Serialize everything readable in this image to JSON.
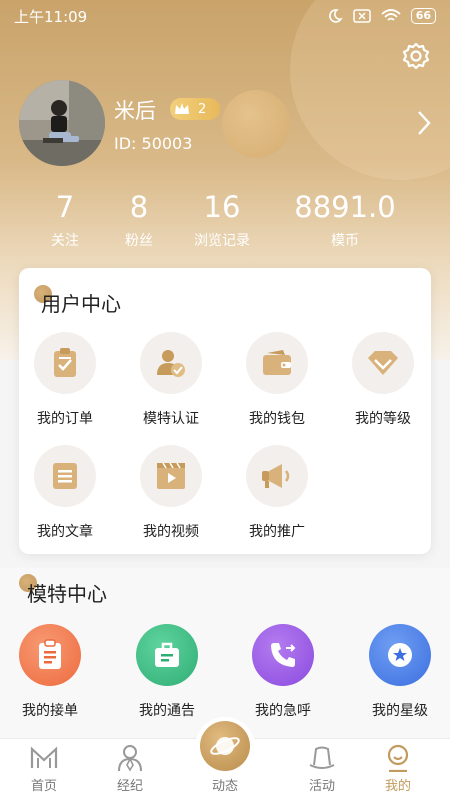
{
  "status_bar": {
    "time": "上午11:09",
    "battery": "66"
  },
  "profile": {
    "name": "米后",
    "vip_level": "2",
    "user_id": "ID: 50003"
  },
  "stats": [
    {
      "value": "7",
      "label": "关注"
    },
    {
      "value": "8",
      "label": "粉丝"
    },
    {
      "value": "16",
      "label": "浏览记录"
    },
    {
      "value": "8891.0",
      "label": "模币"
    }
  ],
  "user_center": {
    "title": "用户中心",
    "items": [
      {
        "label": "我的订单",
        "icon": "order-clipboard-icon"
      },
      {
        "label": "模特认证",
        "icon": "certify-user-icon"
      },
      {
        "label": "我的钱包",
        "icon": "wallet-icon"
      },
      {
        "label": "我的等级",
        "icon": "diamond-icon"
      },
      {
        "label": "我的文章",
        "icon": "article-icon"
      },
      {
        "label": "我的视频",
        "icon": "video-icon"
      },
      {
        "label": "我的推广",
        "icon": "megaphone-icon"
      }
    ]
  },
  "model_center": {
    "title": "模特中心",
    "items": [
      {
        "label": "我的接单",
        "icon": "clipboard-icon",
        "color": "#f27c55"
      },
      {
        "label": "我的通告",
        "icon": "briefcase-icon",
        "color": "#3dbb83"
      },
      {
        "label": "我的急呼",
        "icon": "phone-call-icon",
        "color": "#9b5ce6"
      },
      {
        "label": "我的星级",
        "icon": "star-badge-icon",
        "color": "#4a82ea"
      }
    ]
  },
  "tabbar": {
    "items": [
      {
        "label": "首页"
      },
      {
        "label": "经纪"
      },
      {
        "label": "动态"
      },
      {
        "label": "活动"
      },
      {
        "label": "我的"
      }
    ]
  },
  "colors": {
    "accent": "#c29a5c",
    "header_top": "#c9a36a"
  }
}
